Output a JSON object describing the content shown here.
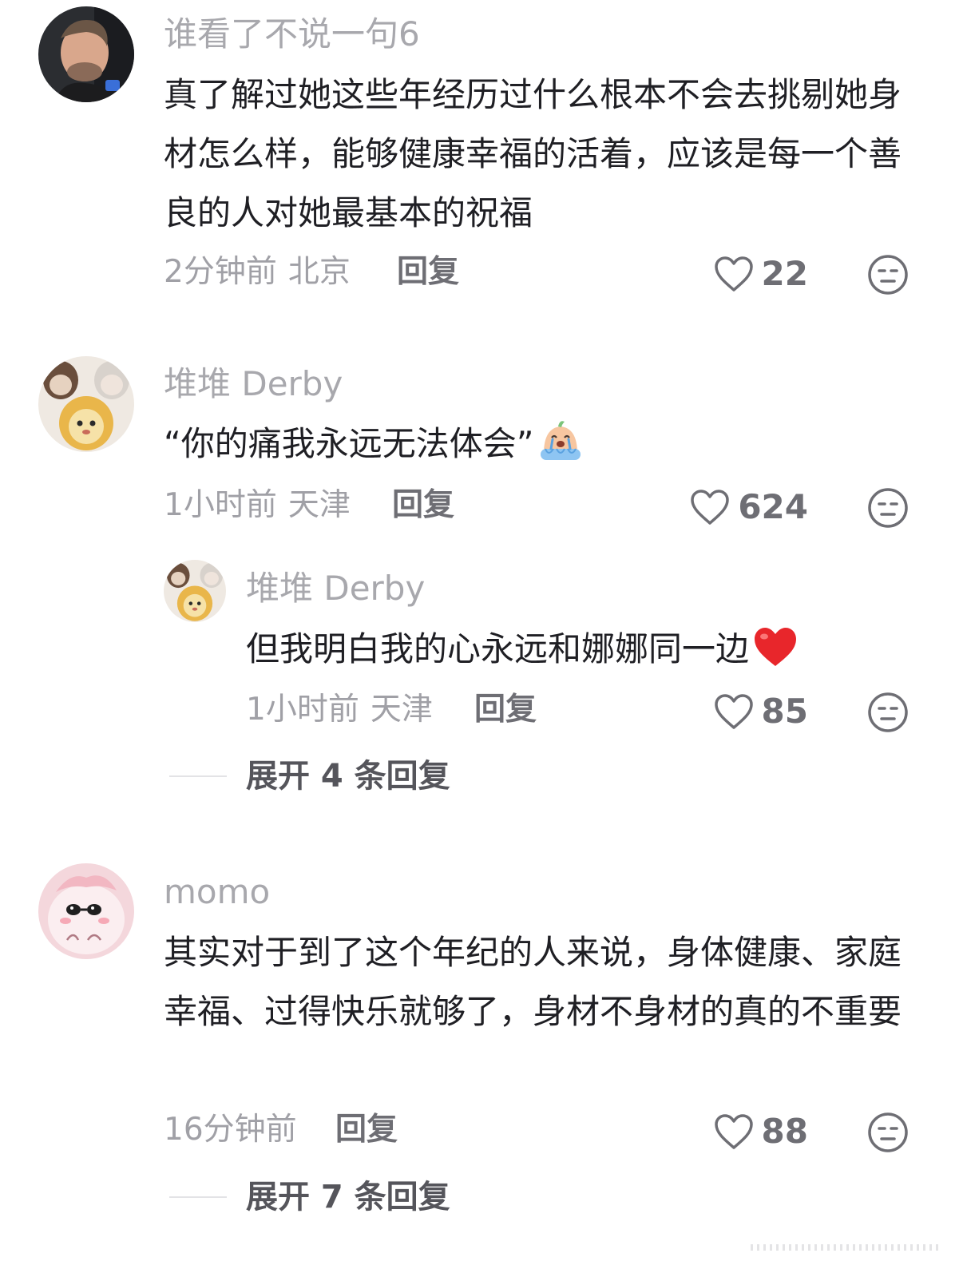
{
  "comments": [
    {
      "username": "谁看了不说一句6",
      "text": "真了解过她这些年经历过什么根本不会去挑剔她身材怎么样，能够健康幸福的活着，应该是每一个善良的人对她最基本的祝福",
      "time": "2分钟前",
      "location": "北京",
      "reply_label": "回复",
      "likes": "22",
      "avatar_icon": "man-portrait-avatar"
    },
    {
      "username": "堆堆 Derby",
      "text": "“你的痛我永远无法体会”",
      "emoji_icon": "crying-face-emoji",
      "time": "1小时前",
      "location": "天津",
      "reply_label": "回复",
      "likes": "624",
      "avatar_icon": "plush-toys-avatar",
      "replies": [
        {
          "username": "堆堆 Derby",
          "text": "但我明白我的心永远和娜娜同一边",
          "emoji_icon": "red-heart-emoji",
          "time": "1小时前",
          "location": "天津",
          "reply_label": "回复",
          "likes": "85",
          "avatar_icon": "plush-toys-avatar"
        }
      ],
      "expand_label": "展开 4 条回复"
    },
    {
      "username": "momo",
      "text": "其实对于到了这个年纪的人来说，身体健康、家庭幸福、过得快乐就够了，身材不身材的真的不重要",
      "time": "16分钟前",
      "location": "",
      "reply_label": "回复",
      "likes": "88",
      "avatar_icon": "pink-cartoon-avatar",
      "expand_label": "展开 7 条回复"
    }
  ],
  "colors": {
    "username": "#a8a8ad",
    "text": "#1f1f24",
    "meta": "#a0a0a6",
    "icon": "#6e6e74",
    "heart_emoji": "#e8262b"
  }
}
